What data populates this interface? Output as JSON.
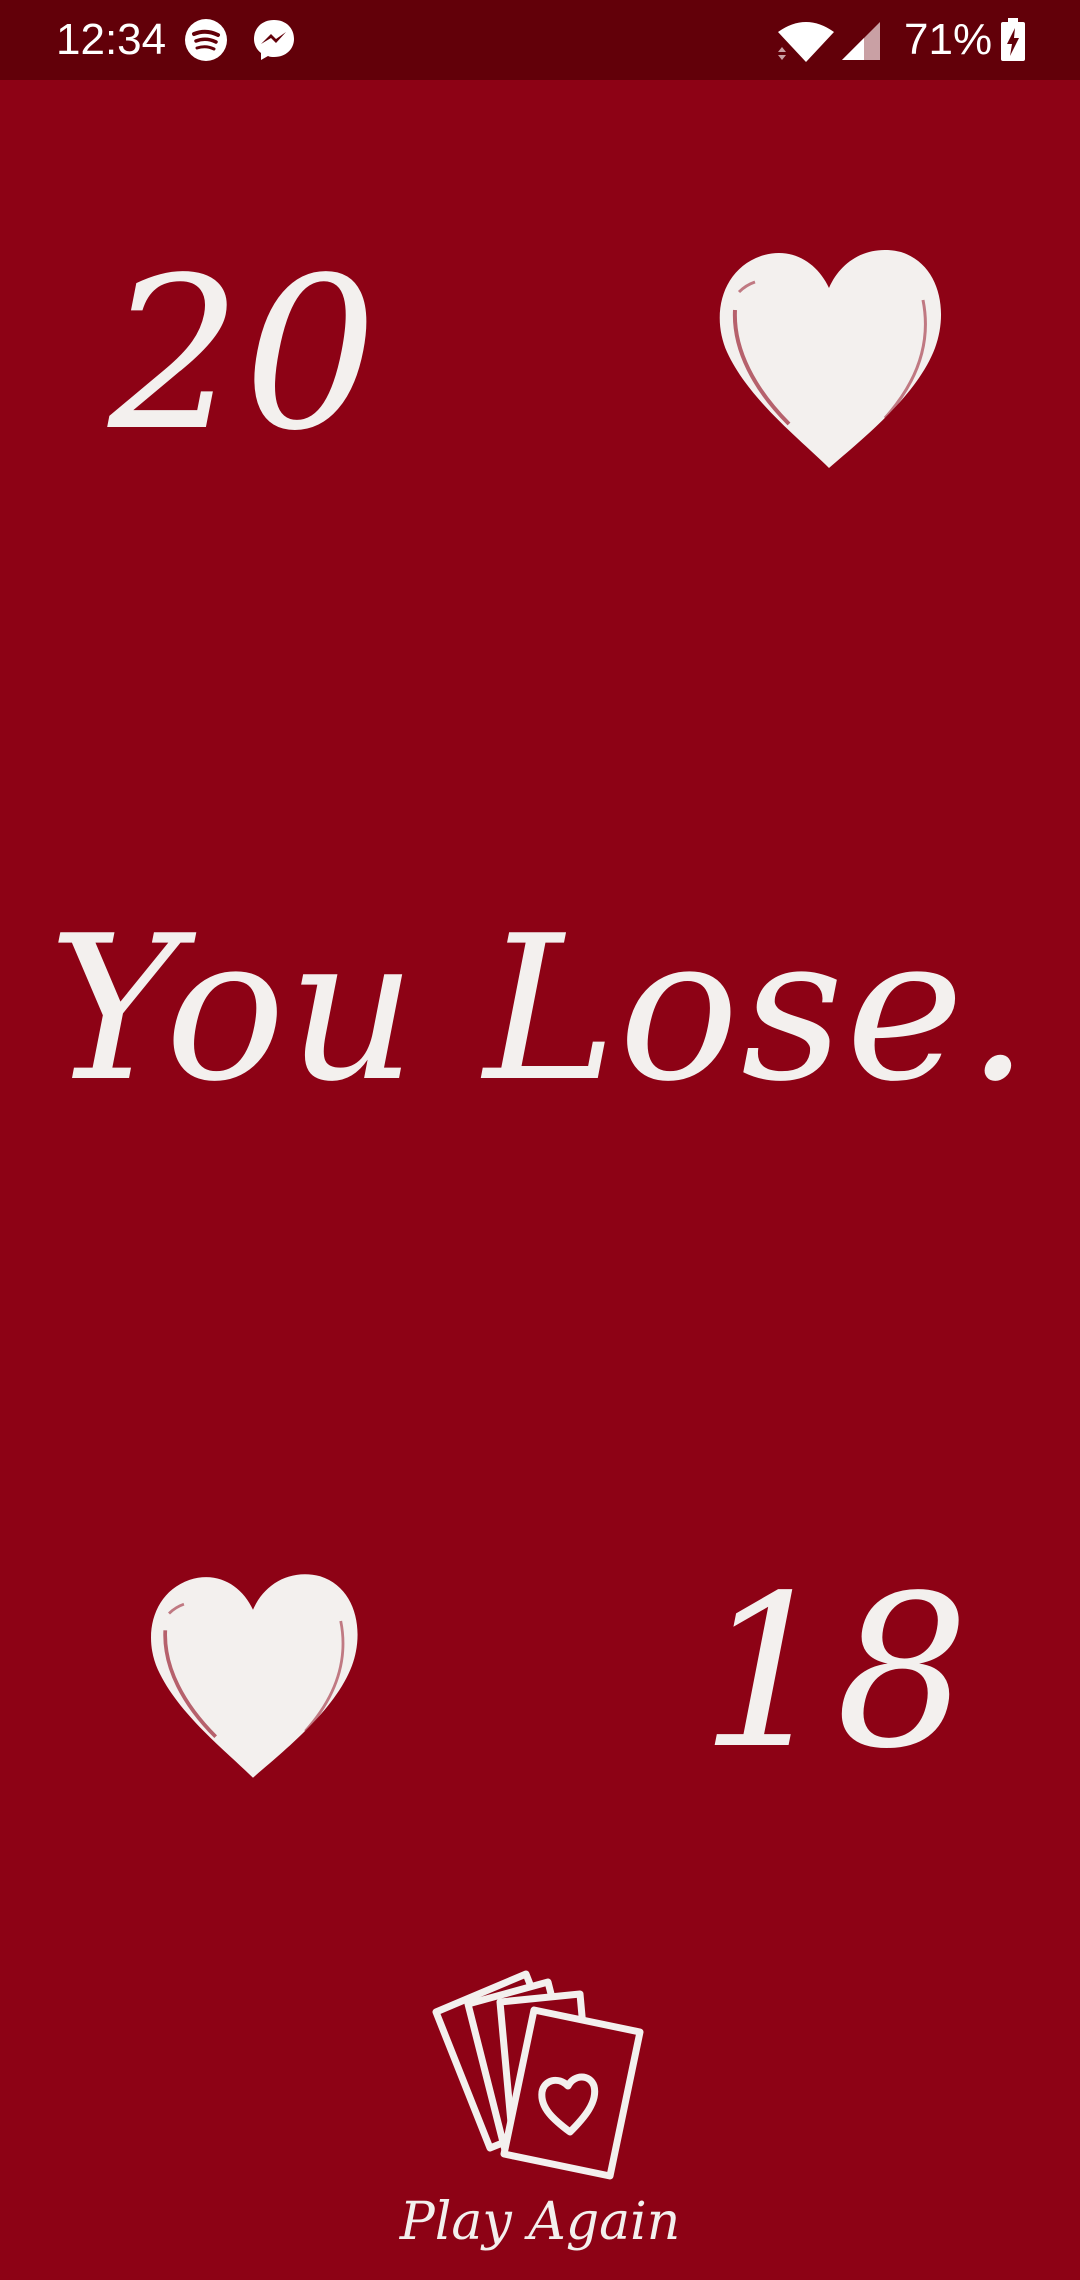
{
  "status_bar": {
    "time": "12:34",
    "battery": "71%",
    "icons": [
      "spotify-icon",
      "messenger-icon",
      "wifi-icon",
      "signal-icon",
      "battery-charging-icon"
    ]
  },
  "game": {
    "opponent_score": "20",
    "player_score": "18",
    "result": "You Lose.",
    "suit_icon": "heart-icon"
  },
  "play_again": {
    "label": "Play Again",
    "icon": "playing-cards-icon"
  },
  "colors": {
    "background": "#8d0215",
    "status_bar": "#620009",
    "foreground": "#f3f0ee"
  }
}
